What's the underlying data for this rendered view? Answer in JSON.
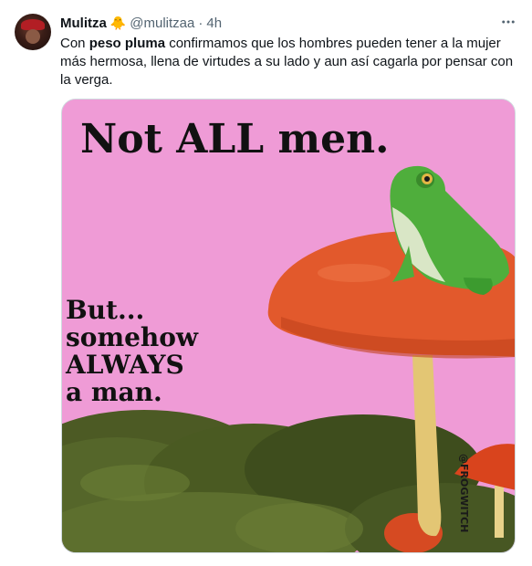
{
  "tweet": {
    "author_name": "Mulitza",
    "emoji": "🐥",
    "handle": "@mulitzaa",
    "separator": "·",
    "time": "4h",
    "text_parts": [
      {
        "text": "Con ",
        "bold": false
      },
      {
        "text": "peso pluma",
        "bold": true
      },
      {
        "text": " confirmamos que los hombres pueden tener a la mujer más hermosa, llena de virtudes a su lado y aun así cagarla por pensar con la verga.",
        "bold": false
      }
    ]
  },
  "media": {
    "headline": "Not ALL men.",
    "subtext_lines": [
      "But...",
      "somehow",
      "ALWAYS",
      "a man."
    ],
    "watermark": "@FROGWITCH",
    "background_color": "#ef9bd6"
  },
  "icons": {
    "more": "more-horizontal-icon"
  }
}
